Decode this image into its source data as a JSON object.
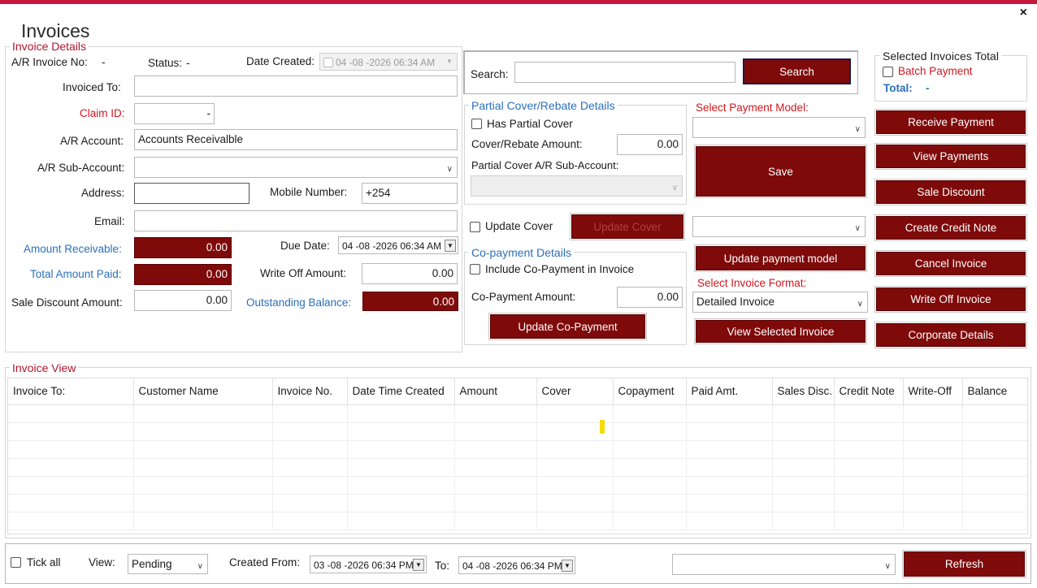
{
  "window": {
    "title": "Invoices",
    "close_label": "×"
  },
  "details": {
    "legend": "Invoice Details",
    "ar_invoice_no_label": "A/R Invoice No:",
    "ar_invoice_no_value": "-",
    "status_label": "Status:",
    "status_value": "-",
    "date_created_label": "Date Created:",
    "date_created_value": "04 -08 -2026  06:34 AM",
    "invoiced_to_label": "Invoiced To:",
    "invoiced_to_value": "",
    "claim_id_label": "Claim ID:",
    "claim_id_value": "-",
    "ar_account_label": "A/R Account:",
    "ar_account_value": "Accounts Receivalble",
    "ar_subaccount_label": "A/R Sub-Account:",
    "ar_subaccount_value": "",
    "address_label": "Address:",
    "address_value": "",
    "mobile_label": "Mobile Number:",
    "mobile_value": "+254",
    "email_label": "Email:",
    "email_value": "",
    "amount_receivable_label": "Amount Receivable:",
    "amount_receivable_value": "0.00",
    "due_date_label": "Due Date:",
    "due_date_value": "04 -08 -2026  06:34 AM",
    "total_paid_label": "Total Amount Paid:",
    "total_paid_value": "0.00",
    "write_off_label": "Write Off Amount:",
    "write_off_value": "0.00",
    "sale_discount_label": "Sale Discount Amount:",
    "sale_discount_value": "0.00",
    "outstanding_label": "Outstanding Balance:",
    "outstanding_value": "0.00"
  },
  "search": {
    "label": "Search:",
    "value": "",
    "button": "Search"
  },
  "partial_cover": {
    "legend": "Partial Cover/Rebate Details",
    "has_partial_label": "Has Partial Cover",
    "amount_label": "Cover/Rebate Amount:",
    "amount_value": "0.00",
    "subaccount_label": "Partial Cover A/R Sub-Account:",
    "subaccount_value": ""
  },
  "update_cover": {
    "checkbox_label": "Update Cover",
    "button": "Update Cover"
  },
  "copayment": {
    "legend": "Co-payment Details",
    "include_label": "Include Co-Payment in Invoice",
    "amount_label": "Co-Payment Amount:",
    "amount_value": "0.00",
    "button": "Update Co-Payment"
  },
  "payment_model": {
    "label": "Select Payment Model:",
    "value": "",
    "save_button": "Save",
    "second_value": "",
    "update_button": "Update payment model"
  },
  "invoice_format": {
    "label": "Select Invoice Format:",
    "value": "Detailed Invoice",
    "view_button": "View Selected Invoice"
  },
  "selected_total": {
    "legend": "Selected Invoices Total",
    "batch_label": "Batch Payment",
    "total_label": "Total:",
    "total_value": "-"
  },
  "actions": {
    "receive": "Receive Payment",
    "view_payments": "View Payments",
    "sale_discount": "Sale Discount",
    "credit_note": "Create Credit Note",
    "cancel": "Cancel Invoice",
    "write_off": "Write Off Invoice",
    "corporate": "Corporate Details"
  },
  "invoice_view": {
    "legend": "Invoice View",
    "columns": [
      "Invoice To:",
      "Customer Name",
      "Invoice No.",
      "Date Time Created",
      "Amount",
      "Cover",
      "Copayment",
      "Paid Amt.",
      "Sales Disc.",
      "Credit Note",
      "Write-Off",
      "Balance"
    ]
  },
  "footer": {
    "tick_all_label": "Tick all",
    "view_label": "View:",
    "view_value": "Pending",
    "created_from_label": "Created From:",
    "created_from_value": "03 -08 -2026  06:34 PM",
    "to_label": "To:",
    "to_value": "04 -08 -2026  06:34 PM",
    "filter_value": "",
    "refresh_button": "Refresh"
  },
  "colors": {
    "accent": "#7f0a0a",
    "top_bar": "#c8173f",
    "label_red": "#d0161e",
    "label_blue": "#2a6fba",
    "marker": "#f5dc00"
  }
}
